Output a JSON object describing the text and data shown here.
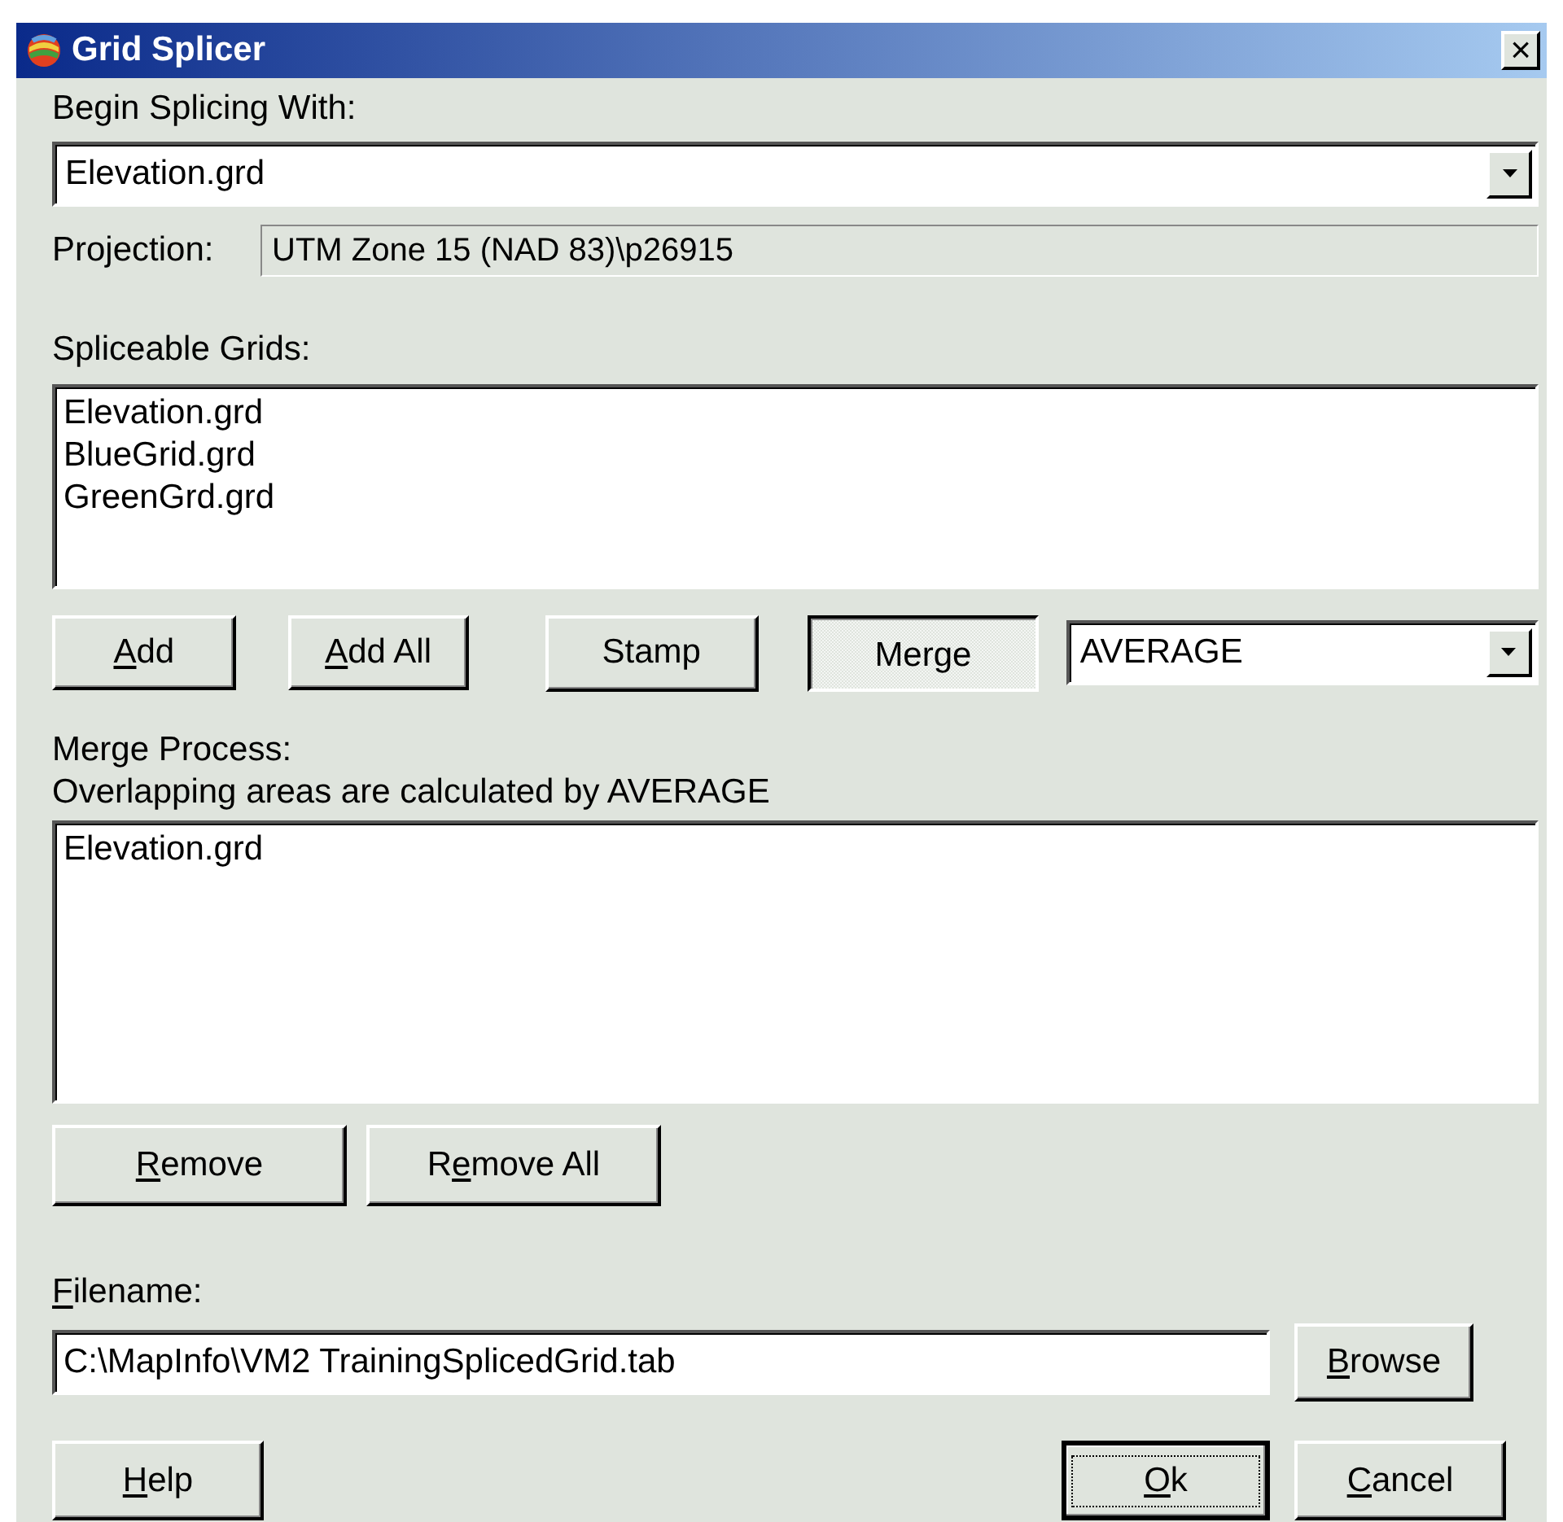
{
  "window": {
    "title": "Grid Splicer",
    "close": "×"
  },
  "begin": {
    "label": "Begin Splicing With:",
    "value": "Elevation.grd"
  },
  "projection": {
    "label": "Projection:",
    "value": "UTM Zone 15 (NAD 83)\\p26915"
  },
  "spliceable": {
    "label": "Spliceable Grids:",
    "items": [
      "Elevation.grd",
      "BlueGrid.grd",
      "GreenGrd.grd"
    ]
  },
  "add_buttons": [
    {
      "parts": {
        "key": "A",
        "after": "dd"
      }
    },
    {
      "parts": {
        "key": "A",
        "after": "dd All"
      }
    }
  ],
  "modes": [
    {
      "label": "Stamp",
      "selected": false
    },
    {
      "label": "Merge",
      "selected": true
    }
  ],
  "method": {
    "value": "AVERAGE"
  },
  "merge": {
    "label": "Merge Process:",
    "description": "Overlapping areas are calculated by AVERAGE",
    "items": [
      "Elevation.grd"
    ]
  },
  "remove_buttons": [
    {
      "parts": {
        "key": "R",
        "after": "emove"
      }
    },
    {
      "parts": {
        "before": "R",
        "key": "e",
        "after": "move All"
      }
    }
  ],
  "filename": {
    "label_parts": {
      "key": "F",
      "after": "ilename:"
    },
    "value": "C:\\MapInfo\\VM2 TrainingSplicedGrid.tab",
    "browse": {
      "key": "B",
      "after": "rowse"
    }
  },
  "footer": [
    {
      "parts": {
        "key": "H",
        "after": "elp"
      },
      "kind": "help",
      "focused": false
    },
    {
      "parts": {
        "key": "O",
        "after": "k"
      },
      "kind": "ok",
      "focused": true
    },
    {
      "parts": {
        "key": "C",
        "after": "ancel"
      },
      "kind": "cancel",
      "focused": false
    }
  ]
}
